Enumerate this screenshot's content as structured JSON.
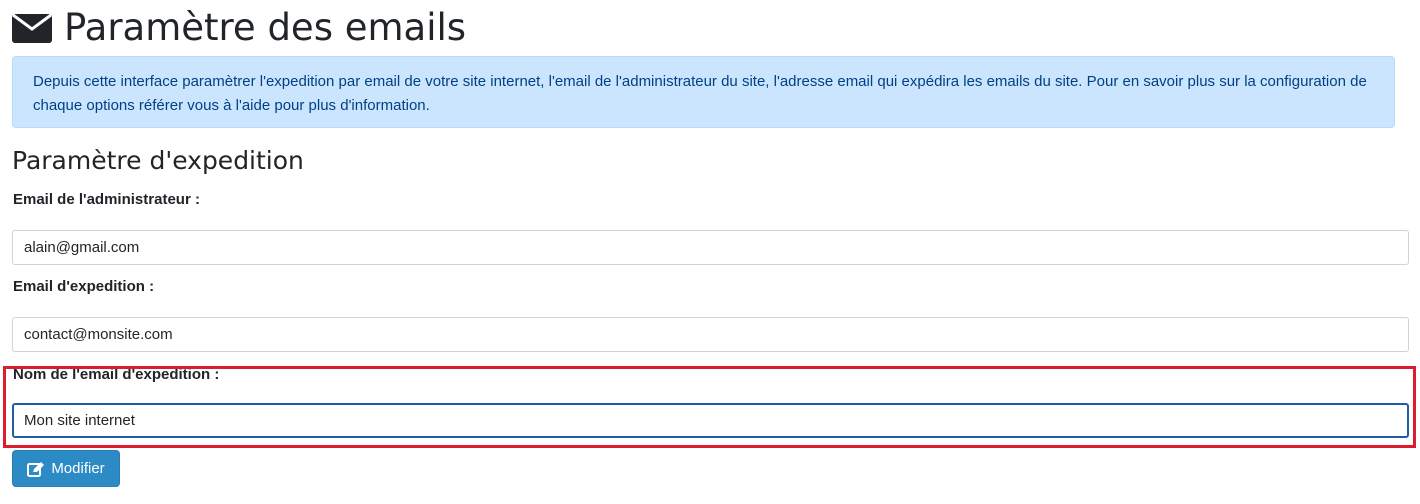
{
  "page": {
    "title": "Paramètre des emails",
    "title_icon": "envelope-icon"
  },
  "info": {
    "text": "Depuis cette interface paramètrer l'expedition par email de votre site internet, l'email de l'administrateur du site, l'adresse email qui expédira les emails du site. Pour en savoir plus sur la configuration de chaque options référer vous à l'aide pour plus d'information."
  },
  "section": {
    "title": "Paramètre d'expedition"
  },
  "form": {
    "admin_email": {
      "label": "Email de l'administrateur :",
      "value": "alain@gmail.com"
    },
    "sender_email": {
      "label": "Email d'expedition :",
      "value": "contact@monsite.com"
    },
    "sender_name": {
      "label": "Nom de l'email d'expedition :",
      "value": "Mon site internet"
    },
    "submit": {
      "label": "Modifier",
      "icon": "edit-icon"
    }
  },
  "colors": {
    "alert_background": "#cce5ff",
    "alert_text": "#004085",
    "button_background": "#2c8ac5",
    "highlight_border": "#dc1d2e",
    "focus_border": "#1d5fa0"
  }
}
